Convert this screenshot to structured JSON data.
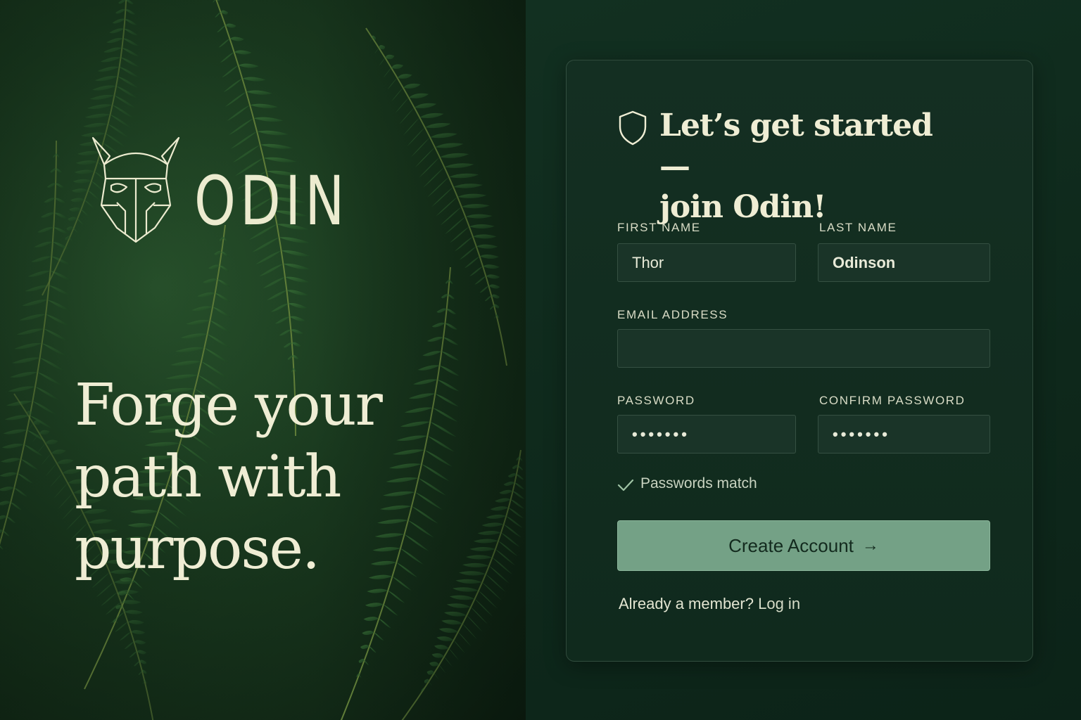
{
  "brand": {
    "name": "ODIN",
    "logo_icon": "viking-helmet-icon",
    "tagline_line1": "Forge your",
    "tagline_line2": "path with",
    "tagline_line3": "purpose."
  },
  "form": {
    "heading_icon": "shield-icon",
    "heading_line1": "Let’s get started —",
    "heading_line2": "join Odin!",
    "first_name": {
      "label": "FIRST NAME",
      "value": "Thor"
    },
    "last_name": {
      "label": "LAST NAME",
      "value": "Odinson"
    },
    "email": {
      "label": "EMAIL ADDRESS",
      "value": ""
    },
    "password": {
      "label": "PASSWORD",
      "value": "•••••••"
    },
    "confirm_password": {
      "label": "CONFIRM PASSWORD",
      "value": "•••••••"
    },
    "validation": {
      "icon": "check-icon",
      "text": "Passwords match"
    },
    "submit": {
      "label": "Create Account",
      "icon": "arrow-right-icon",
      "arrow": "→"
    },
    "footer": {
      "question": "Already a member?",
      "link": "Log in"
    }
  },
  "colors": {
    "panel_bg": "#0f2a1d",
    "cream_text": "#efedd4",
    "button_bg": "#74a186",
    "button_text": "#132a1e"
  }
}
